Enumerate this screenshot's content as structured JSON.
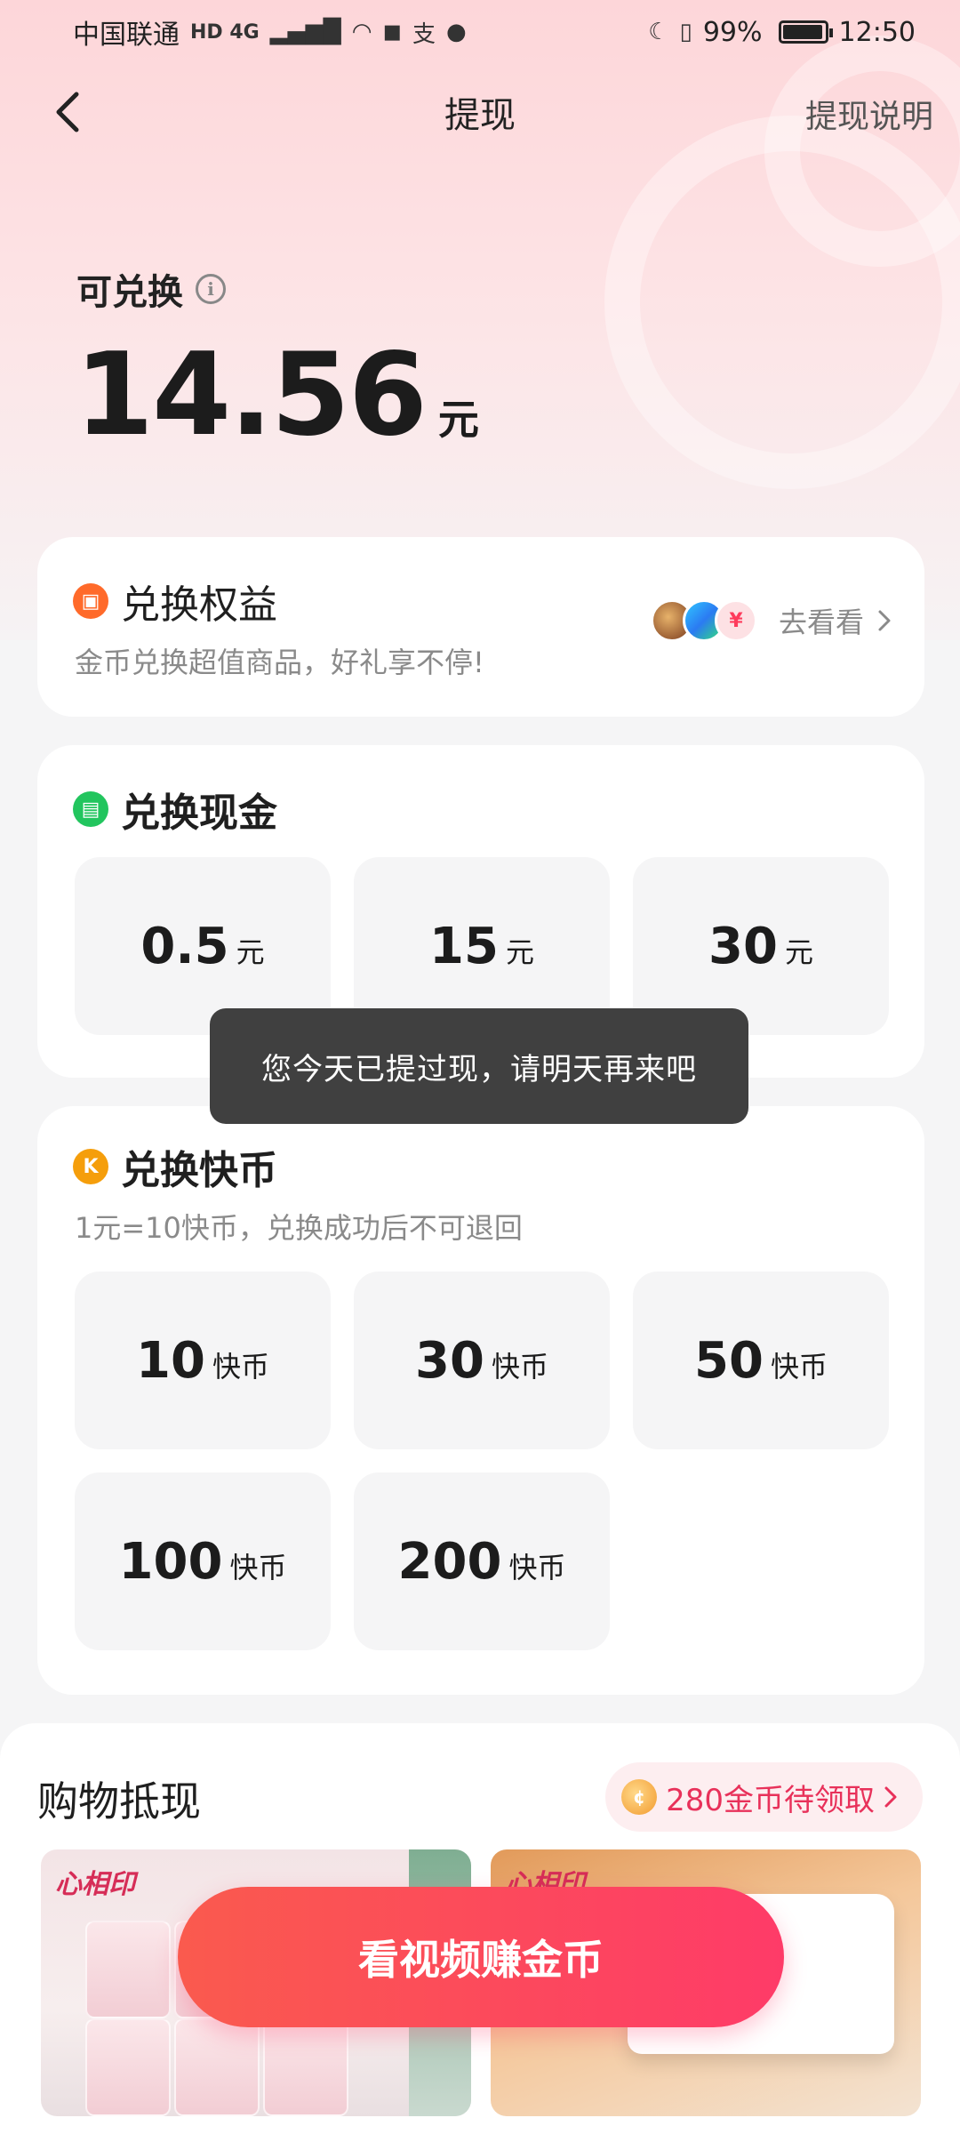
{
  "status_bar": {
    "carrier": "中国联通",
    "network": "HD 4G",
    "battery_percent": "99%",
    "time": "12:50"
  },
  "nav": {
    "title": "提现",
    "help_link": "提现说明"
  },
  "balance": {
    "label": "可兑换",
    "amount": "14.56",
    "unit": "元"
  },
  "rights": {
    "title": "兑换权益",
    "subtitle": "金币兑换超值商品，好礼享不停!",
    "link": "去看看",
    "badge_char": "¥"
  },
  "cash": {
    "title": "兑换现金",
    "options": [
      {
        "amount": "0.5",
        "unit": "元"
      },
      {
        "amount": "15",
        "unit": "元"
      },
      {
        "amount": "30",
        "unit": "元"
      }
    ]
  },
  "coins": {
    "title": "兑换快币",
    "badge_char": "K",
    "subtitle": "1元=10快币，兑换成功后不可退回",
    "options": [
      {
        "amount": "10",
        "unit": "快币"
      },
      {
        "amount": "30",
        "unit": "快币"
      },
      {
        "amount": "50",
        "unit": "快币"
      },
      {
        "amount": "100",
        "unit": "快币"
      },
      {
        "amount": "200",
        "unit": "快币"
      }
    ]
  },
  "toast": {
    "message": "您今天已提过现，请明天再来吧"
  },
  "shop": {
    "title": "购物抵现",
    "pill": "280金币待领取",
    "brand_1": "心相印",
    "brand_2": "心相印"
  },
  "cta": {
    "label": "看视频赚金币"
  },
  "colors": {
    "accent": "#fe3b68",
    "cash_badge": "#22c55e",
    "rights_badge": "#ff6a2a",
    "coin_badge": "#f59e0b"
  }
}
